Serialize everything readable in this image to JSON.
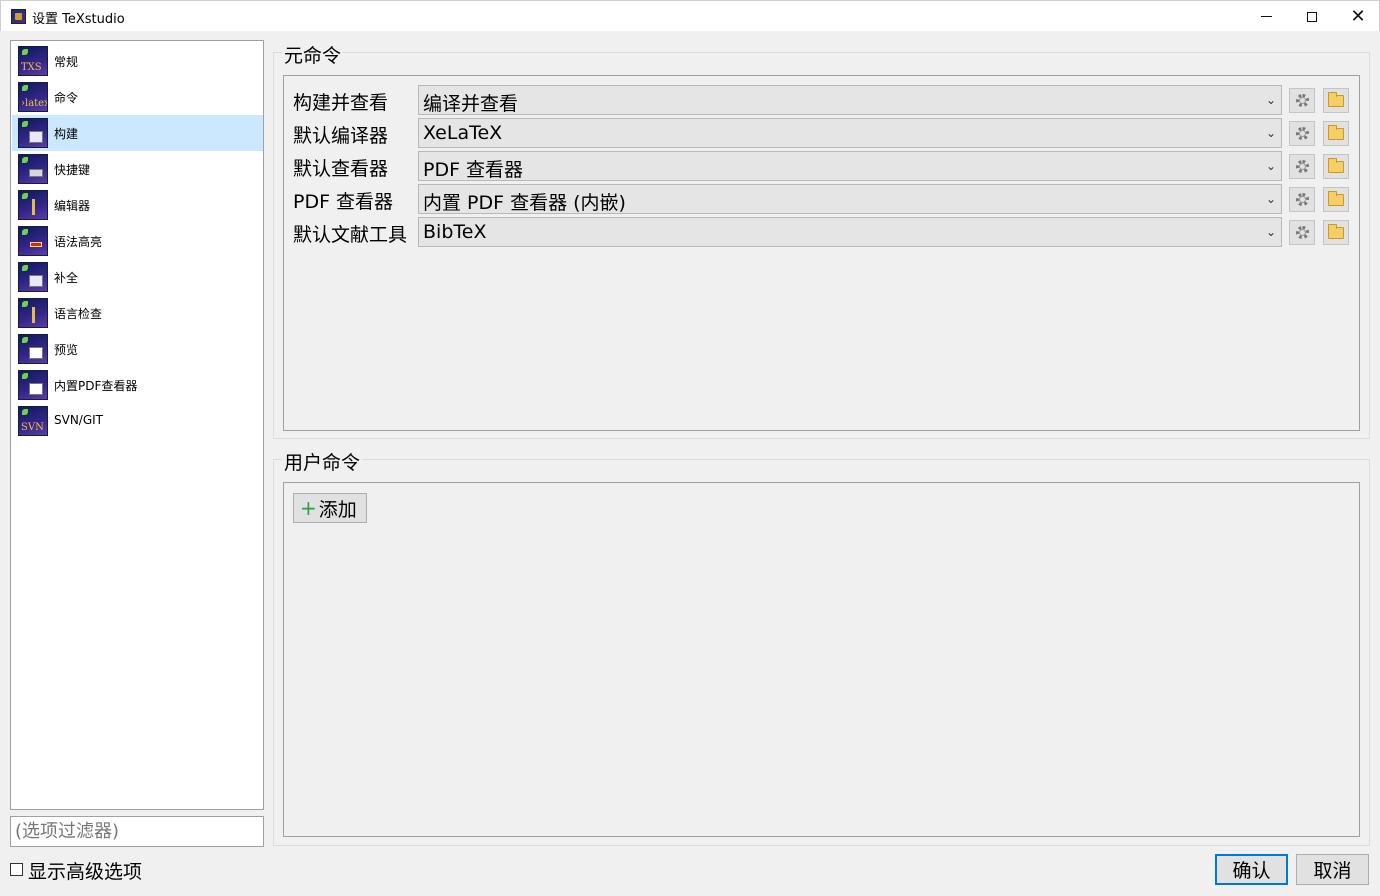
{
  "window": {
    "title": "设置 TeXstudio",
    "controls": [
      "minimize",
      "maximize",
      "close"
    ]
  },
  "sidebar": {
    "items": [
      {
        "label": "常规",
        "icon": "txs-icon",
        "icon_text": "TXS"
      },
      {
        "label": "命令",
        "icon": "latex-icon",
        "icon_text": "›latex"
      },
      {
        "label": "构建",
        "icon": "build-icon",
        "icon_text": ""
      },
      {
        "label": "快捷键",
        "icon": "keyboard-icon",
        "icon_text": ""
      },
      {
        "label": "编辑器",
        "icon": "editor-cursor-icon",
        "icon_text": ""
      },
      {
        "label": "语法高亮",
        "icon": "highlight-icon",
        "icon_text": ""
      },
      {
        "label": "补全",
        "icon": "completion-icon",
        "icon_text": ""
      },
      {
        "label": "语言检查",
        "icon": "language-check-icon",
        "icon_text": ""
      },
      {
        "label": "预览",
        "icon": "preview-icon",
        "icon_text": ""
      },
      {
        "label": "内置PDF查看器",
        "icon": "pdf-viewer-icon",
        "icon_text": ""
      },
      {
        "label": "SVN/GIT",
        "icon": "svn-icon",
        "icon_text": "SVN"
      }
    ],
    "selected_index": 2,
    "filter_placeholder": "(选项过滤器)",
    "show_advanced_label": "显示高级选项",
    "show_advanced_checked": false
  },
  "meta_commands": {
    "title": "元命令",
    "rows": [
      {
        "label": "构建并查看",
        "value": "编译并查看"
      },
      {
        "label": "默认编译器",
        "value": "XeLaTeX"
      },
      {
        "label": "默认查看器",
        "value": "PDF 查看器"
      },
      {
        "label": "PDF 查看器",
        "value": "内置 PDF 查看器 (内嵌)"
      },
      {
        "label": "默认文献工具",
        "value": "BibTeX"
      }
    ]
  },
  "user_commands": {
    "title": "用户命令",
    "add_label": "添加"
  },
  "buttons": {
    "ok": "确认",
    "cancel": "取消"
  },
  "colors": {
    "selection": "#cce8ff",
    "accent": "#0078d7",
    "background": "#f0f0f0"
  }
}
